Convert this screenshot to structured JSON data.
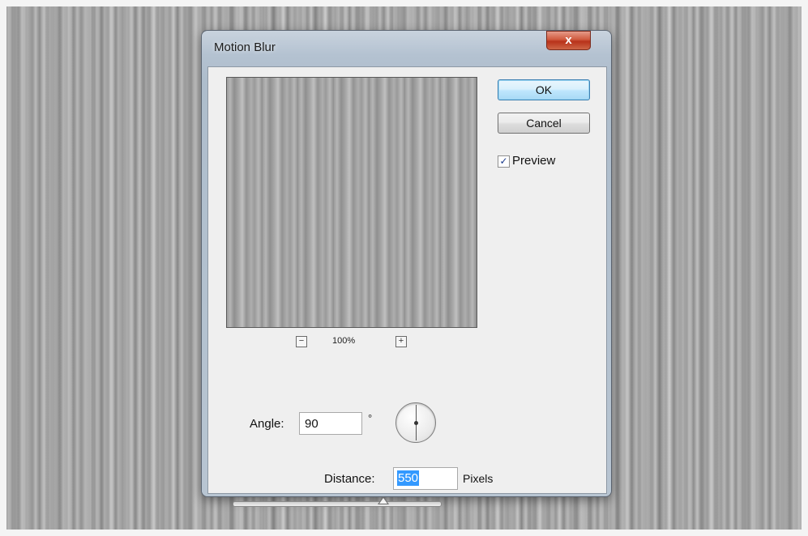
{
  "dialog": {
    "title": "Motion Blur",
    "close_label": "x"
  },
  "preview": {
    "zoom_out_symbol": "−",
    "zoom_level": "100%",
    "zoom_in_symbol": "+"
  },
  "buttons": {
    "ok_label": "OK",
    "cancel_label": "Cancel"
  },
  "preview_toggle": {
    "label": "Preview",
    "checked": true,
    "check_mark": "✓"
  },
  "angle": {
    "label": "Angle:",
    "value": "90",
    "unit": "°",
    "degrees": 90
  },
  "distance": {
    "label": "Distance:",
    "value": "550",
    "unit": "Pixels",
    "slider_fraction": 0.72
  },
  "colors": {
    "selection_highlight": "#3399ff",
    "close_button": "#c8452c",
    "ok_button_border": "#3c7fb1"
  }
}
